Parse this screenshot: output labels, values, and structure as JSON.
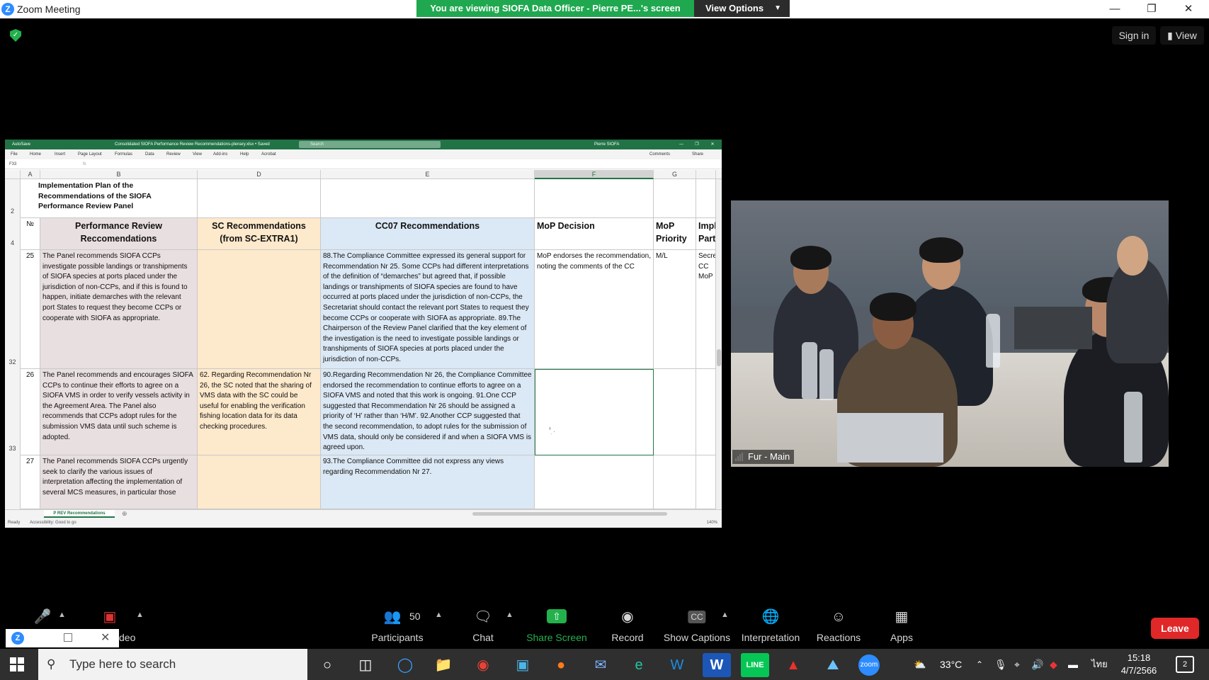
{
  "window": {
    "title": "Zoom Meeting",
    "banner": "You are viewing SIOFA Data Officer - Pierre PE...'s screen",
    "view_options": "View Options",
    "sign_in": "Sign in",
    "view": "View"
  },
  "excel": {
    "autosave": "AutoSave",
    "filename": "Consolidated SIOFA Performance Review Recommendations-plenary.xlsx • Saved",
    "search": "Search",
    "user": "Pierre SIOFA",
    "ribbon_tabs": [
      "File",
      "Home",
      "Insert",
      "Page Layout",
      "Formulas",
      "Data",
      "Review",
      "View",
      "Add-ins",
      "Help",
      "Acrobat"
    ],
    "comments": "Comments",
    "share": "Share",
    "name_box": "F33",
    "columns": [
      "A",
      "B",
      "D",
      "E",
      "F",
      "G"
    ],
    "selected_column": "F",
    "title_cell": "Implementation Plan of the Recommendations of the SIOFA Performance Review Panel",
    "headers": {
      "no": "№",
      "b": "Performance Review Reccomendations",
      "d": "SC Recommendations (from SC-EXTRA1)",
      "e": "CC07 Recommendations",
      "f": "MoP Decision",
      "g": "MoP Priority",
      "h": "Impl Party"
    },
    "row_numbers": [
      "2",
      "4",
      "32",
      "33"
    ],
    "rows": [
      {
        "no": "25",
        "b": "The Panel recommends SIOFA CCPs investigate possible landings or transhipments of SIOFA species at ports placed under the jurisdiction of non-CCPs, and if this is found to happen, initiate demarches with the relevant port States to request they become CCPs or cooperate with SIOFA as appropriate.",
        "d": "",
        "e": "88.The Compliance Committee expressed its general support for Recommendation Nr 25. Some CCPs had different interpretations of the definition of “demarches” but agreed that, if possible landings or transhipments of SIOFA species are found to have occurred at ports placed under the jurisdiction of non-CCPs, the Secretariat should contact the relevant port States to request they become CCPs or cooperate with SIOFA as appropriate. 89.The Chairperson of the Review Panel clarified that the key element of the investigation is the need to investigate possible landings or transhipments of SIOFA species at ports placed under the jurisdiction of non-CCPs.",
        "f": "MoP endorses the recommendation, noting the comments of the CC",
        "g": "M/L",
        "h": "Secret CC MoP"
      },
      {
        "no": "26",
        "b": "The Panel recommends and encourages SIOFA CCPs to continue their efforts to agree on a SIOFA VMS in order to verify vessels activity in the Agreement Area. The Panel also recommends that CCPs adopt rules for the submission VMS data until such scheme is adopted.",
        "d": "62. Regarding Recommendation Nr 26, the SC noted that the sharing of VMS data with the SC could be useful for enabling the verification fishing location data for its data checking procedures.",
        "e": "90.Regarding Recommendation Nr 26, the Compliance Committee endorsed the recommendation to continue efforts to agree on a SIOFA VMS and noted that this work is ongoing. 91.One CCP suggested that Recommendation Nr 26 should be assigned a priority of ‘H’ rather than ‘H/M’. 92.Another CCP suggested that the second recommendation, to adopt rules for the submission of VMS data, should only be considered if and when a SIOFA VMS is agreed upon.",
        "f": "",
        "g": "",
        "h": ""
      },
      {
        "no": "27",
        "b": "The Panel recommends SIOFA CCPs urgently seek to clarify the various issues of interpretation affecting the implementation of several MCS measures, in particular those",
        "d": "",
        "e": "93.The Compliance Committee did not express any views regarding Recommendation Nr 27.",
        "f": "",
        "g": "",
        "h": ""
      }
    ],
    "sheet_tab": "P REV Recommendations",
    "status": "Ready",
    "accessibility": "Accessibility: Good to go",
    "zoom": "140%"
  },
  "video": {
    "name": "Fur - Main"
  },
  "toolbar": {
    "participants_count": "50",
    "participants": "Participants",
    "chat": "Chat",
    "share_screen": "Share Screen",
    "record": "Record",
    "show_captions": "Show Captions",
    "interpretation": "Interpretation",
    "reactions": "Reactions",
    "apps": "Apps",
    "video_partial": "deo",
    "leave": "Leave"
  },
  "taskbar": {
    "search_placeholder": "Type here to search",
    "temperature": "33°C",
    "language": "ไทย",
    "time": "15:18",
    "date": "4/7/2566",
    "notifications": "2"
  }
}
